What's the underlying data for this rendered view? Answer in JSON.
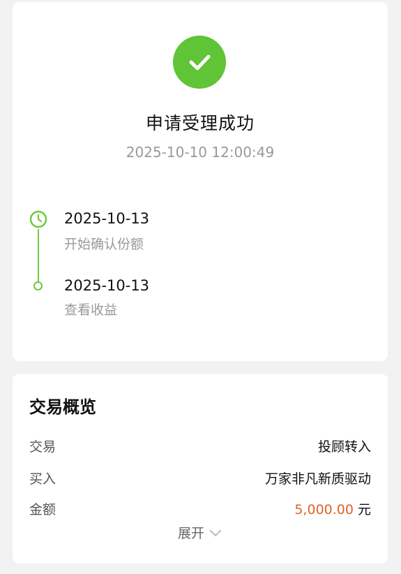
{
  "status": {
    "title": "申请受理成功",
    "time": "2025-10-10 12:00:49",
    "icon": "check-circle-icon",
    "accent_color": "#5fc436"
  },
  "timeline": [
    {
      "date": "2025-10-13",
      "desc": "开始确认份额",
      "icon": "clock-icon"
    },
    {
      "date": "2025-10-13",
      "desc": "查看收益",
      "icon": "dot-icon"
    }
  ],
  "overview": {
    "title": "交易概览",
    "rows": [
      {
        "label": "交易",
        "value": "投顾转入"
      },
      {
        "label": "买入",
        "value": "万家非凡新质驱动"
      },
      {
        "label": "金额",
        "value": "5,000.00",
        "unit": "元",
        "value_color": "#e0622a"
      }
    ],
    "expand_label": "展开",
    "expand_icon": "chevron-down-icon"
  }
}
